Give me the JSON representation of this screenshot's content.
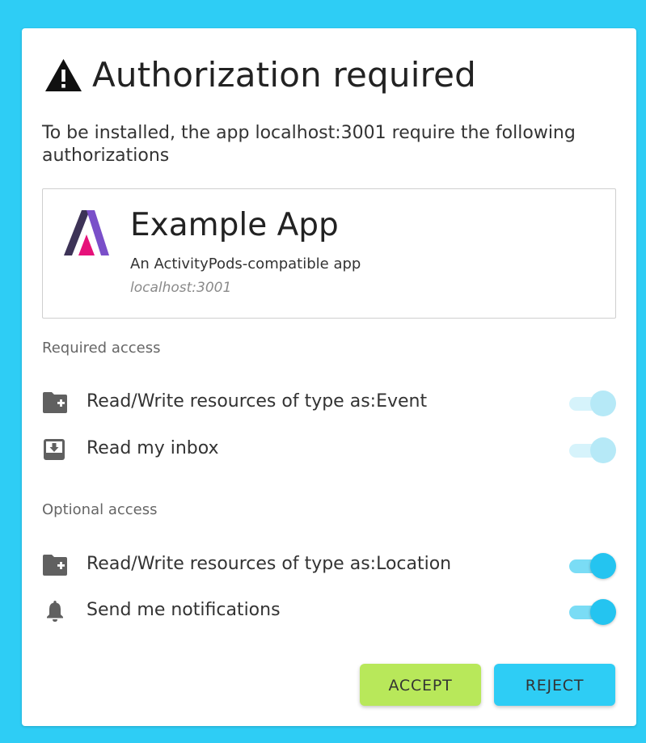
{
  "dialog": {
    "title": "Authorization required",
    "intro": "To be installed, the app localhost:3001 require the following authorizations"
  },
  "app": {
    "name": "Example App",
    "description": "An ActivityPods-compatible app",
    "url": "localhost:3001",
    "logo_icon": "activitypods-logo-icon"
  },
  "required_access": {
    "label": "Required access",
    "items": [
      {
        "icon": "folder-plus-icon",
        "label": "Read/Write resources of type as:Event",
        "enabled": true,
        "disabled": true
      },
      {
        "icon": "inbox-download-icon",
        "label": "Read my inbox",
        "enabled": true,
        "disabled": true
      }
    ]
  },
  "optional_access": {
    "label": "Optional access",
    "items": [
      {
        "icon": "folder-plus-icon",
        "label": "Read/Write resources of type as:Location",
        "enabled": true,
        "disabled": false
      },
      {
        "icon": "bell-icon",
        "label": "Send me notifications",
        "enabled": true,
        "disabled": false
      }
    ]
  },
  "actions": {
    "accept_label": "ACCEPT",
    "reject_label": "REJECT"
  },
  "colors": {
    "background": "#2ecdf5",
    "accept": "#b8e85a",
    "reject": "#2ecdf5",
    "toggle_on": "#24c4f0"
  }
}
